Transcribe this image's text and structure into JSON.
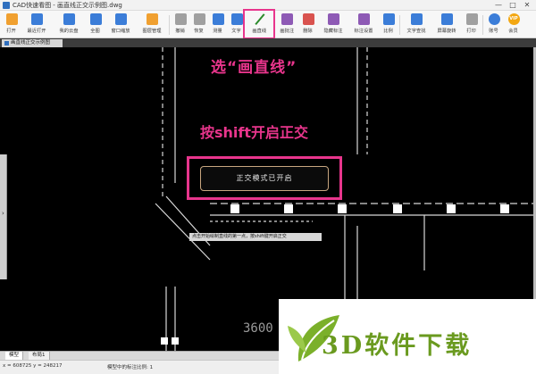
{
  "window": {
    "title": "CAD快速看图 - 画直线正交示例图.dwg",
    "controls": [
      "—",
      "□",
      "✕"
    ]
  },
  "toolbar": {
    "tools": [
      {
        "label": "打开",
        "icon": "open-folder-icon"
      },
      {
        "label": "最近打开",
        "icon": "recent-icon"
      },
      {
        "label": "我的云盘",
        "icon": "cloud-icon"
      },
      {
        "label": "全图",
        "icon": "fit-all-icon"
      },
      {
        "label": "窗口缩放",
        "icon": "zoom-window-icon"
      },
      {
        "label": "图层管理",
        "icon": "layers-icon"
      },
      {
        "label": "撤销",
        "icon": "undo-icon"
      },
      {
        "label": "恢复",
        "icon": "redo-icon"
      },
      {
        "label": "测量",
        "icon": "measure-icon"
      },
      {
        "label": "文字",
        "icon": "text-icon"
      },
      {
        "label": "画直线",
        "icon": "draw-line-icon"
      },
      {
        "label": "画批注",
        "icon": "pen-icon"
      },
      {
        "label": "删除",
        "icon": "delete-icon"
      },
      {
        "label": "隐藏标注",
        "icon": "hide-annotation-icon"
      },
      {
        "label": "标注设置",
        "icon": "annotation-settings-icon"
      },
      {
        "label": "比例",
        "icon": "scale-icon"
      },
      {
        "label": "文字查找",
        "icon": "text-search-icon"
      },
      {
        "label": "屏幕旋转",
        "icon": "rotate-icon"
      },
      {
        "label": "打印",
        "icon": "print-icon"
      },
      {
        "label": "账号",
        "icon": "account-icon"
      },
      {
        "label": "会员",
        "icon": "vip-icon"
      }
    ],
    "vip_badge": "VIP",
    "highlight_color": "#e8358c"
  },
  "document": {
    "tab_label": "画直线正交示例图"
  },
  "canvas": {
    "caption_select": "选“画直线”",
    "caption_shift": "按shift开启正交",
    "ortho_message": "正交模式已开启",
    "command_tip": "点击开始绘制直线的第一点，按shift键开启正交",
    "dimension_text": "3600",
    "side_handle": "›"
  },
  "layout_tabs": [
    "模型",
    "布局1"
  ],
  "status": {
    "coords": "x = 608725  y = 248217",
    "scale": "模型中的标注比例: 1"
  },
  "watermark": {
    "text": "3D软件下载",
    "colors": {
      "leaf": "#6a9a1f",
      "accent": "#e8358c"
    }
  }
}
